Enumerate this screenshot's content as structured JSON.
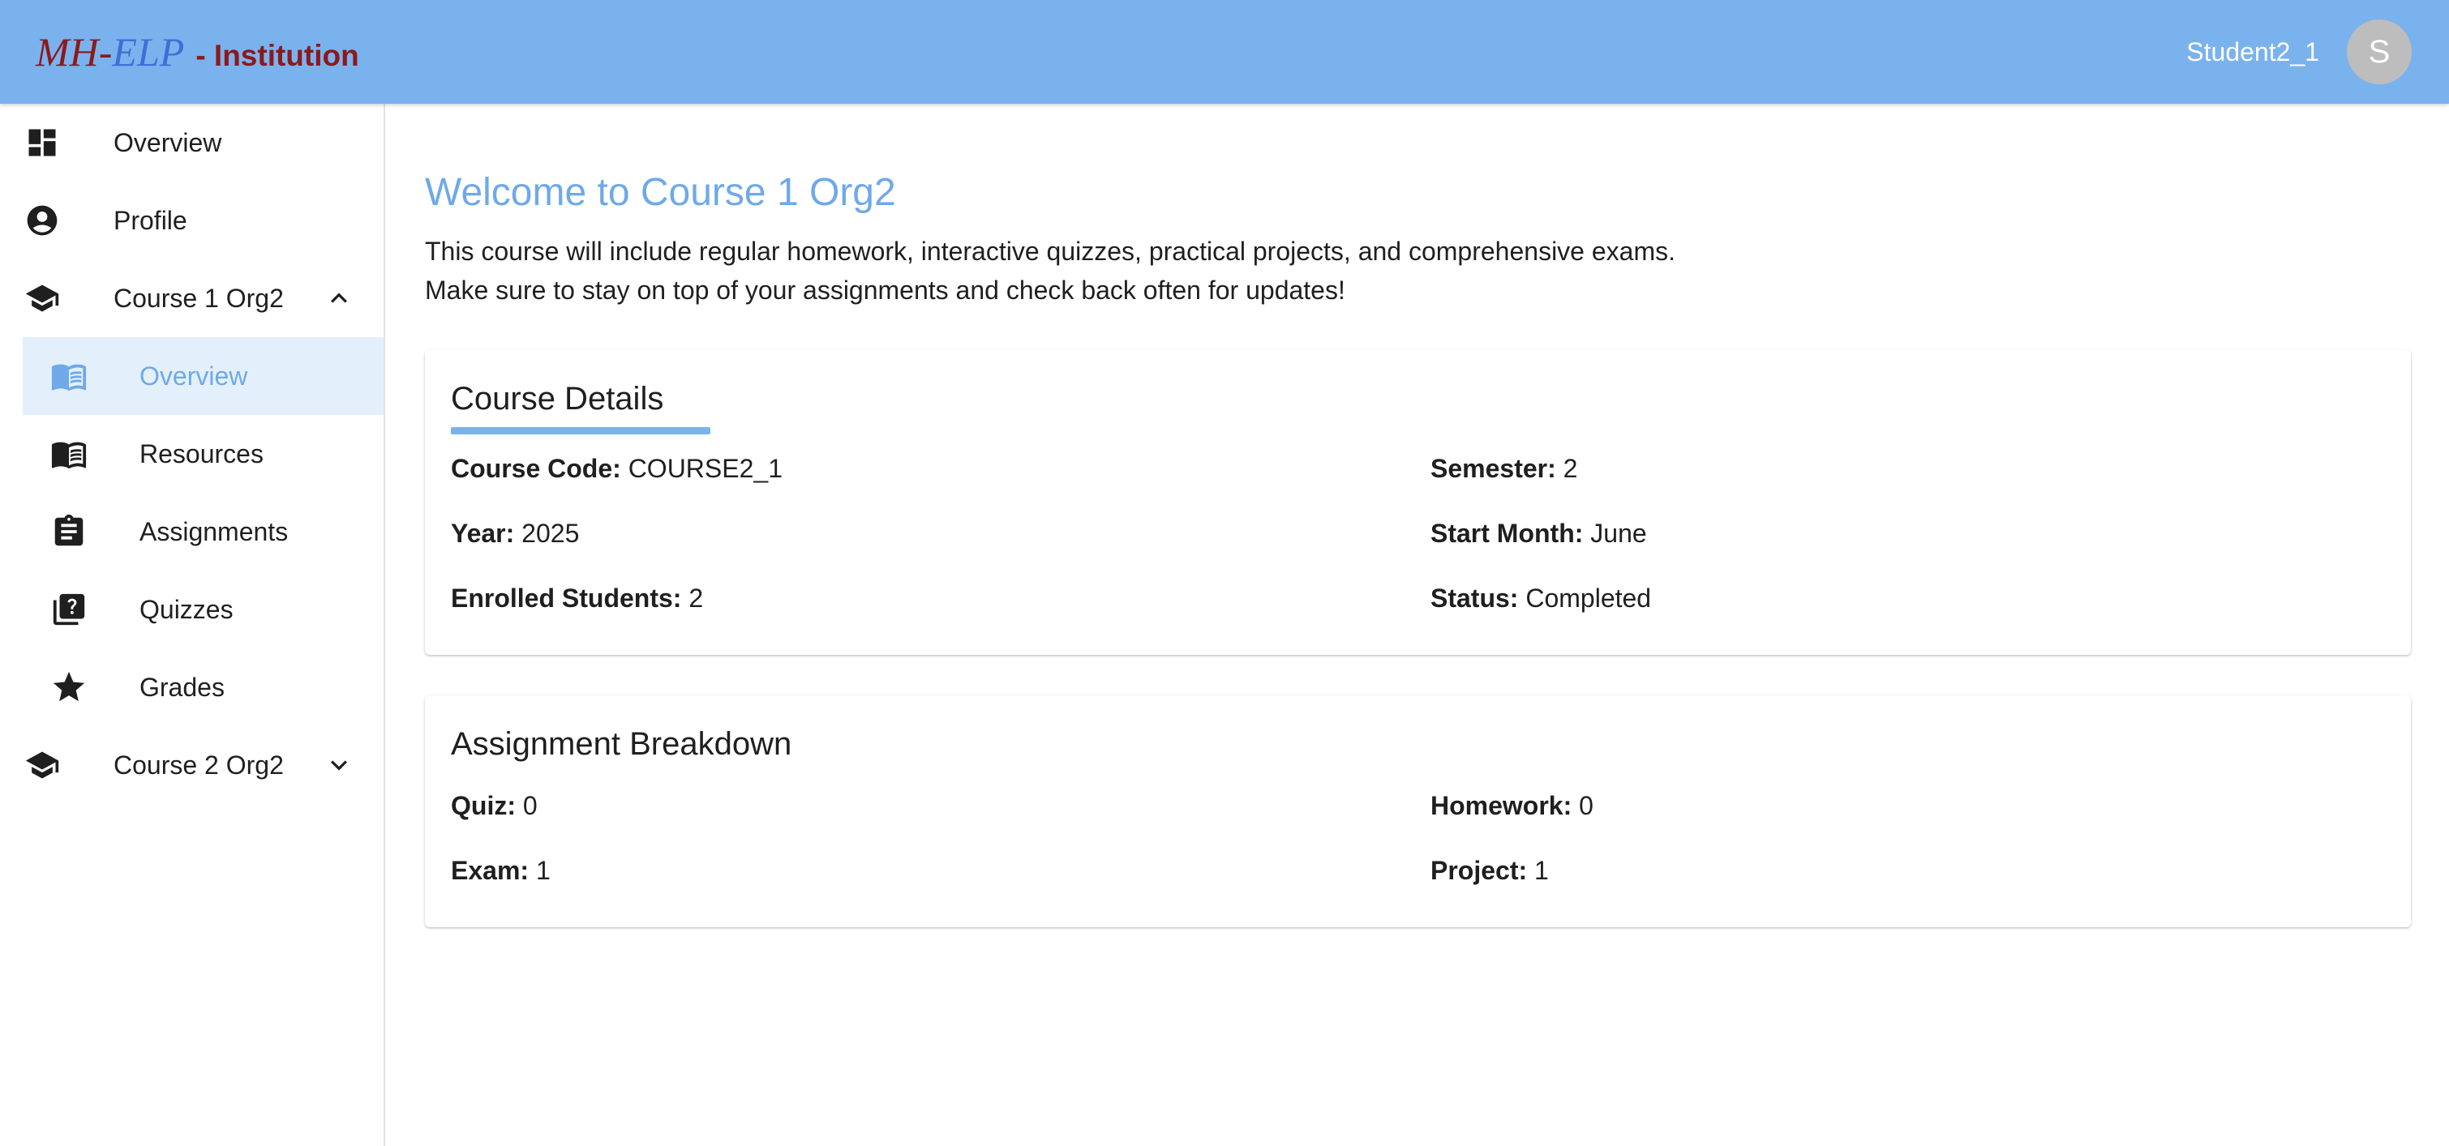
{
  "header": {
    "logo_mh": "MH",
    "logo_dash": "-",
    "logo_elp": "ELP",
    "logo_suffix": "- Institution",
    "username": "Student2_1",
    "avatar_initial": "S"
  },
  "sidebar": {
    "items": [
      {
        "label": "Overview",
        "icon": "dashboard-icon"
      },
      {
        "label": "Profile",
        "icon": "account-circle-icon"
      },
      {
        "label": "Course 1 Org2",
        "icon": "school-icon",
        "expanded": true
      },
      {
        "label": "Course 2 Org2",
        "icon": "school-icon",
        "expanded": false
      }
    ],
    "course1_subitems": [
      {
        "label": "Overview",
        "icon": "menu-book-icon",
        "active": true
      },
      {
        "label": "Resources",
        "icon": "menu-book-icon"
      },
      {
        "label": "Assignments",
        "icon": "assignment-icon"
      },
      {
        "label": "Quizzes",
        "icon": "quiz-icon"
      },
      {
        "label": "Grades",
        "icon": "star-icon"
      }
    ]
  },
  "main": {
    "welcome": "Welcome to Course 1 Org2",
    "description_line1": "This course will include regular homework, interactive quizzes, practical projects, and comprehensive exams.",
    "description_line2": "Make sure to stay on top of your assignments and check back often for updates!",
    "course_details": {
      "title": "Course Details",
      "course_code_label": "Course Code:",
      "course_code": "COURSE2_1",
      "semester_label": "Semester:",
      "semester": "2",
      "year_label": "Year:",
      "year": "2025",
      "start_month_label": "Start Month:",
      "start_month": "June",
      "enrolled_label": "Enrolled Students:",
      "enrolled": "2",
      "status_label": "Status:",
      "status": "Completed"
    },
    "assignment_breakdown": {
      "title": "Assignment Breakdown",
      "quiz_label": "Quiz:",
      "quiz": "0",
      "homework_label": "Homework:",
      "homework": "0",
      "exam_label": "Exam:",
      "exam": "1",
      "project_label": "Project:",
      "project": "1"
    }
  },
  "colors": {
    "appbar": "#7ab2ee",
    "accent": "#6fa9e8",
    "active_bg": "#e3f0fc",
    "brand_red": "#8b1a1a",
    "brand_blue": "#3d6fd8"
  }
}
